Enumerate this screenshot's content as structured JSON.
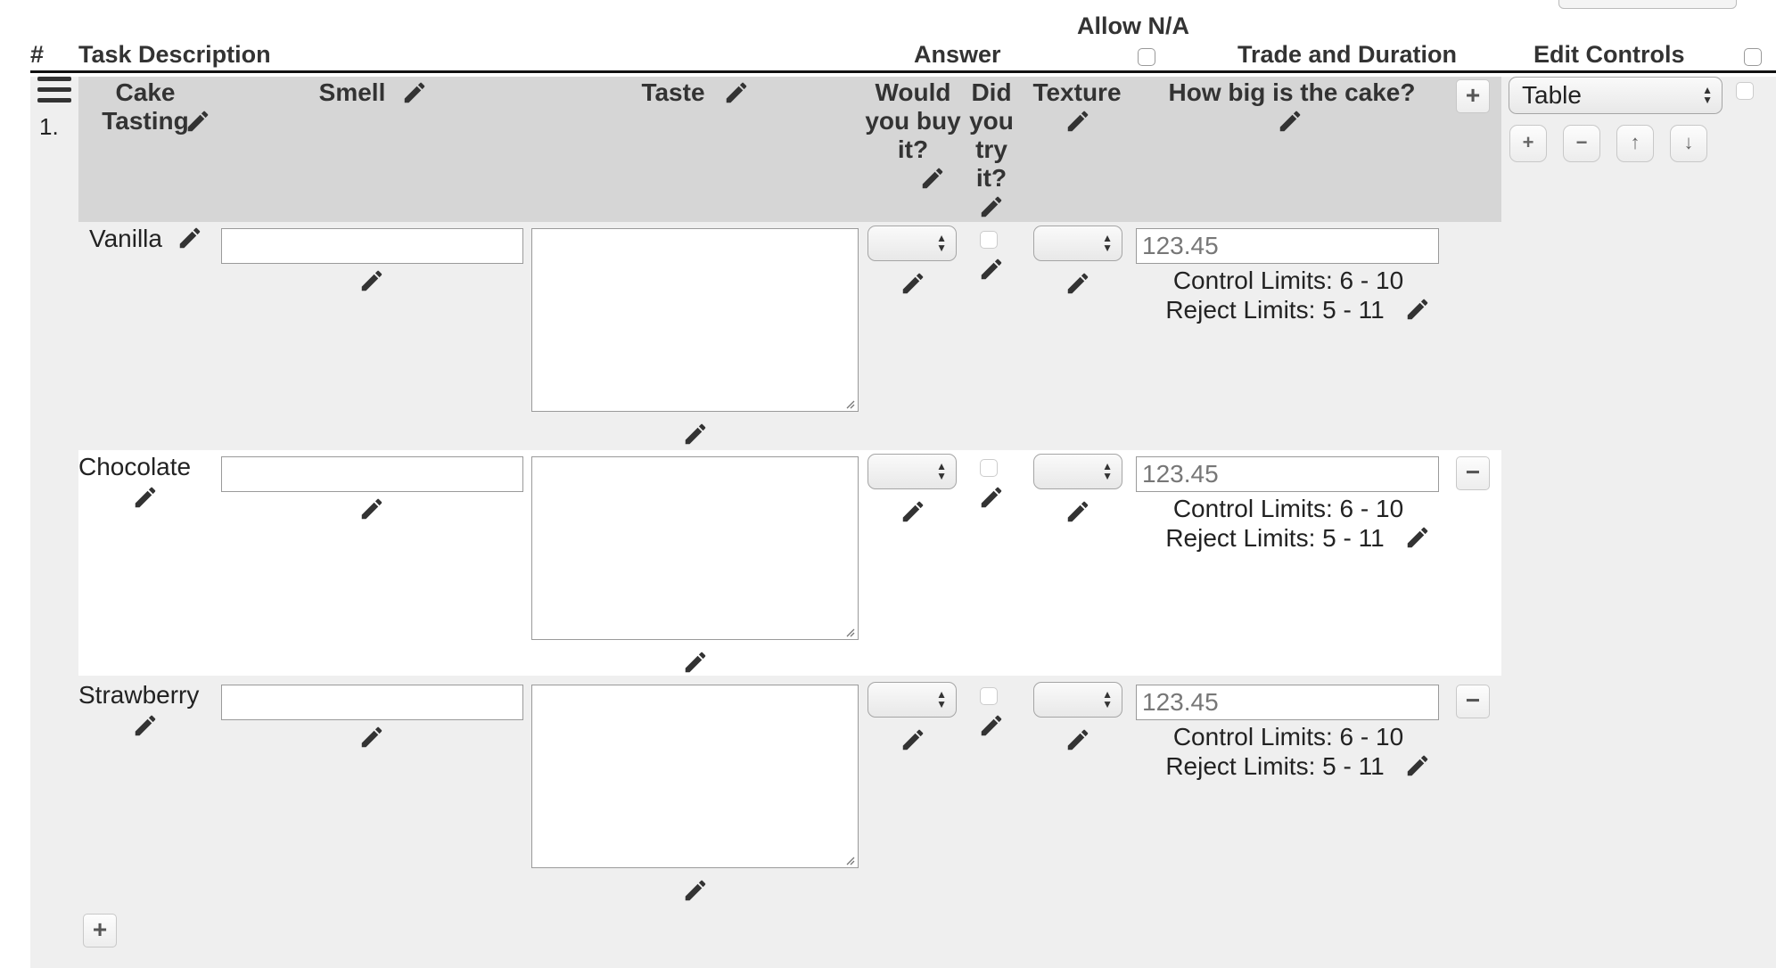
{
  "header": {
    "hash": "#",
    "task_description": "Task Description",
    "answer": "Answer",
    "allow_na": "Allow N/A",
    "trade_duration": "Trade and Duration",
    "edit_controls": "Edit Controls"
  },
  "task": {
    "number": "1.",
    "name": "Cake Tasting",
    "columns": {
      "smell": "Smell",
      "taste": "Taste",
      "would_buy": "Would you buy it?",
      "did_try": "Did you try it?",
      "texture": "Texture",
      "how_big": "How big is the cake?"
    },
    "view_select": "Table",
    "add_column_symbol": "+",
    "edit_buttons": [
      "+",
      "−",
      "↑",
      "↓"
    ]
  },
  "rows": [
    {
      "label": "Vanilla",
      "placeholder": "123.45",
      "control_limits": "Control Limits: 6 - 10",
      "reject_limits": "Reject Limits: 5 - 11"
    },
    {
      "label": "Chocolate",
      "placeholder": "123.45",
      "control_limits": "Control Limits: 6 - 10",
      "reject_limits": "Reject Limits: 5 - 11",
      "remove_symbol": "−"
    },
    {
      "label": "Strawberry",
      "placeholder": "123.45",
      "control_limits": "Control Limits: 6 - 10",
      "reject_limits": "Reject Limits: 5 - 11",
      "remove_symbol": "−"
    }
  ],
  "add_row_symbol": "+",
  "icons": {
    "edit": "pencil-icon",
    "menu": "hamburger-menu-icon"
  }
}
